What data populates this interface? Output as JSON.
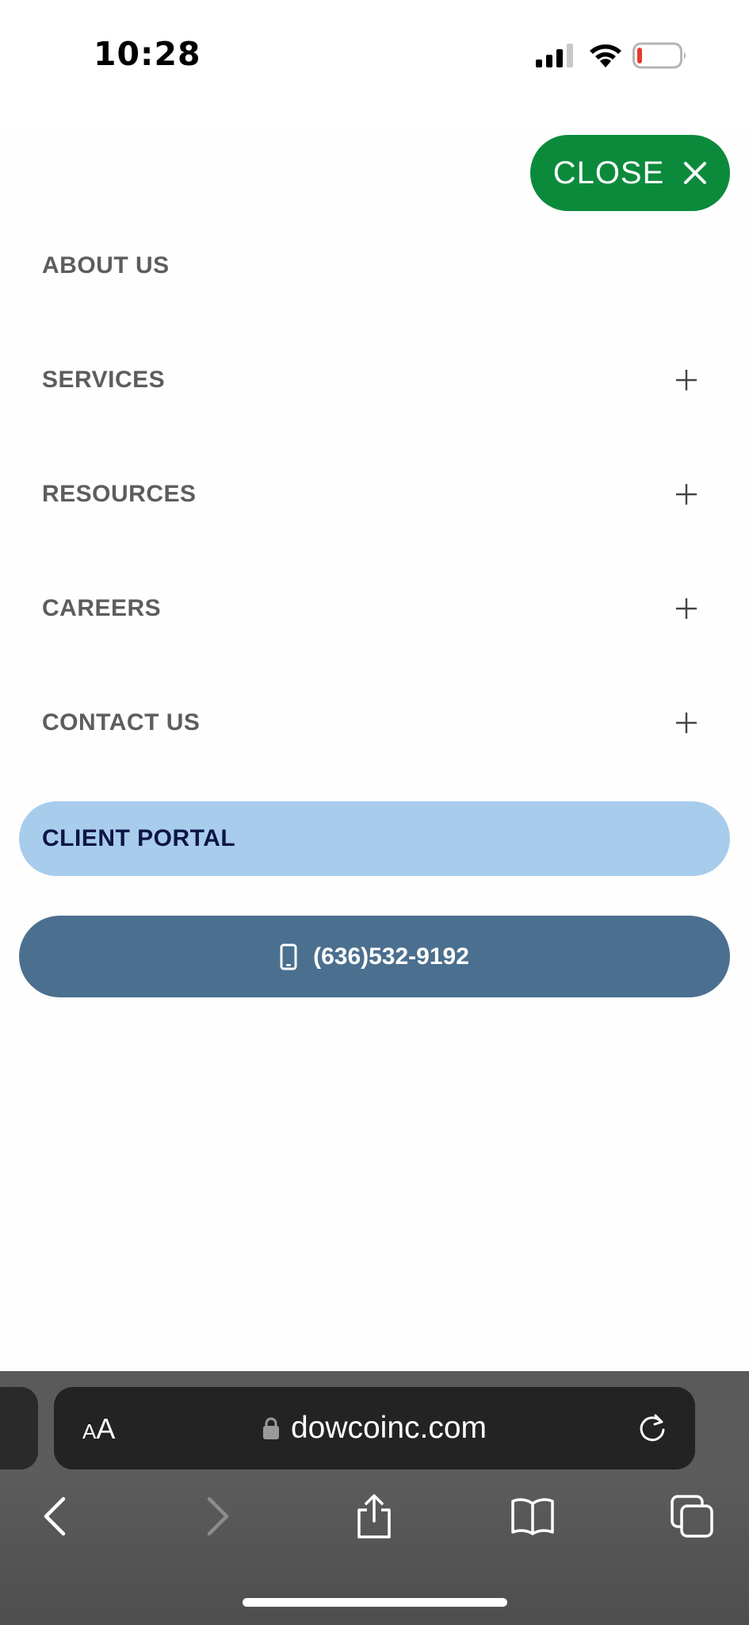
{
  "status_bar": {
    "time": "10:28"
  },
  "menu": {
    "close_label": "CLOSE",
    "items": [
      {
        "label": "ABOUT US",
        "expandable": false
      },
      {
        "label": "SERVICES",
        "expandable": true
      },
      {
        "label": "RESOURCES",
        "expandable": true
      },
      {
        "label": "CAREERS",
        "expandable": true
      },
      {
        "label": "CONTACT US",
        "expandable": true
      }
    ],
    "client_portal_label": "CLIENT PORTAL",
    "phone_label": "(636)532-9192"
  },
  "browser": {
    "text_size_small": "A",
    "text_size_big": "A",
    "url": "dowcoinc.com"
  },
  "colors": {
    "close_button": "#0b8a3c",
    "menu_text": "#5d5d5d",
    "client_portal_bg": "#a8ccec",
    "client_portal_text": "#0d1546",
    "phone_button_bg": "#4b6f8e"
  },
  "icons": {
    "close": "close-x-icon",
    "expand": "plus-icon",
    "phone": "mobile-phone-icon",
    "lock": "lock-icon",
    "reload": "reload-icon",
    "back": "chevron-left-icon",
    "forward": "chevron-right-icon",
    "share": "share-icon",
    "bookmarks": "book-icon",
    "tabs": "tabs-icon"
  }
}
